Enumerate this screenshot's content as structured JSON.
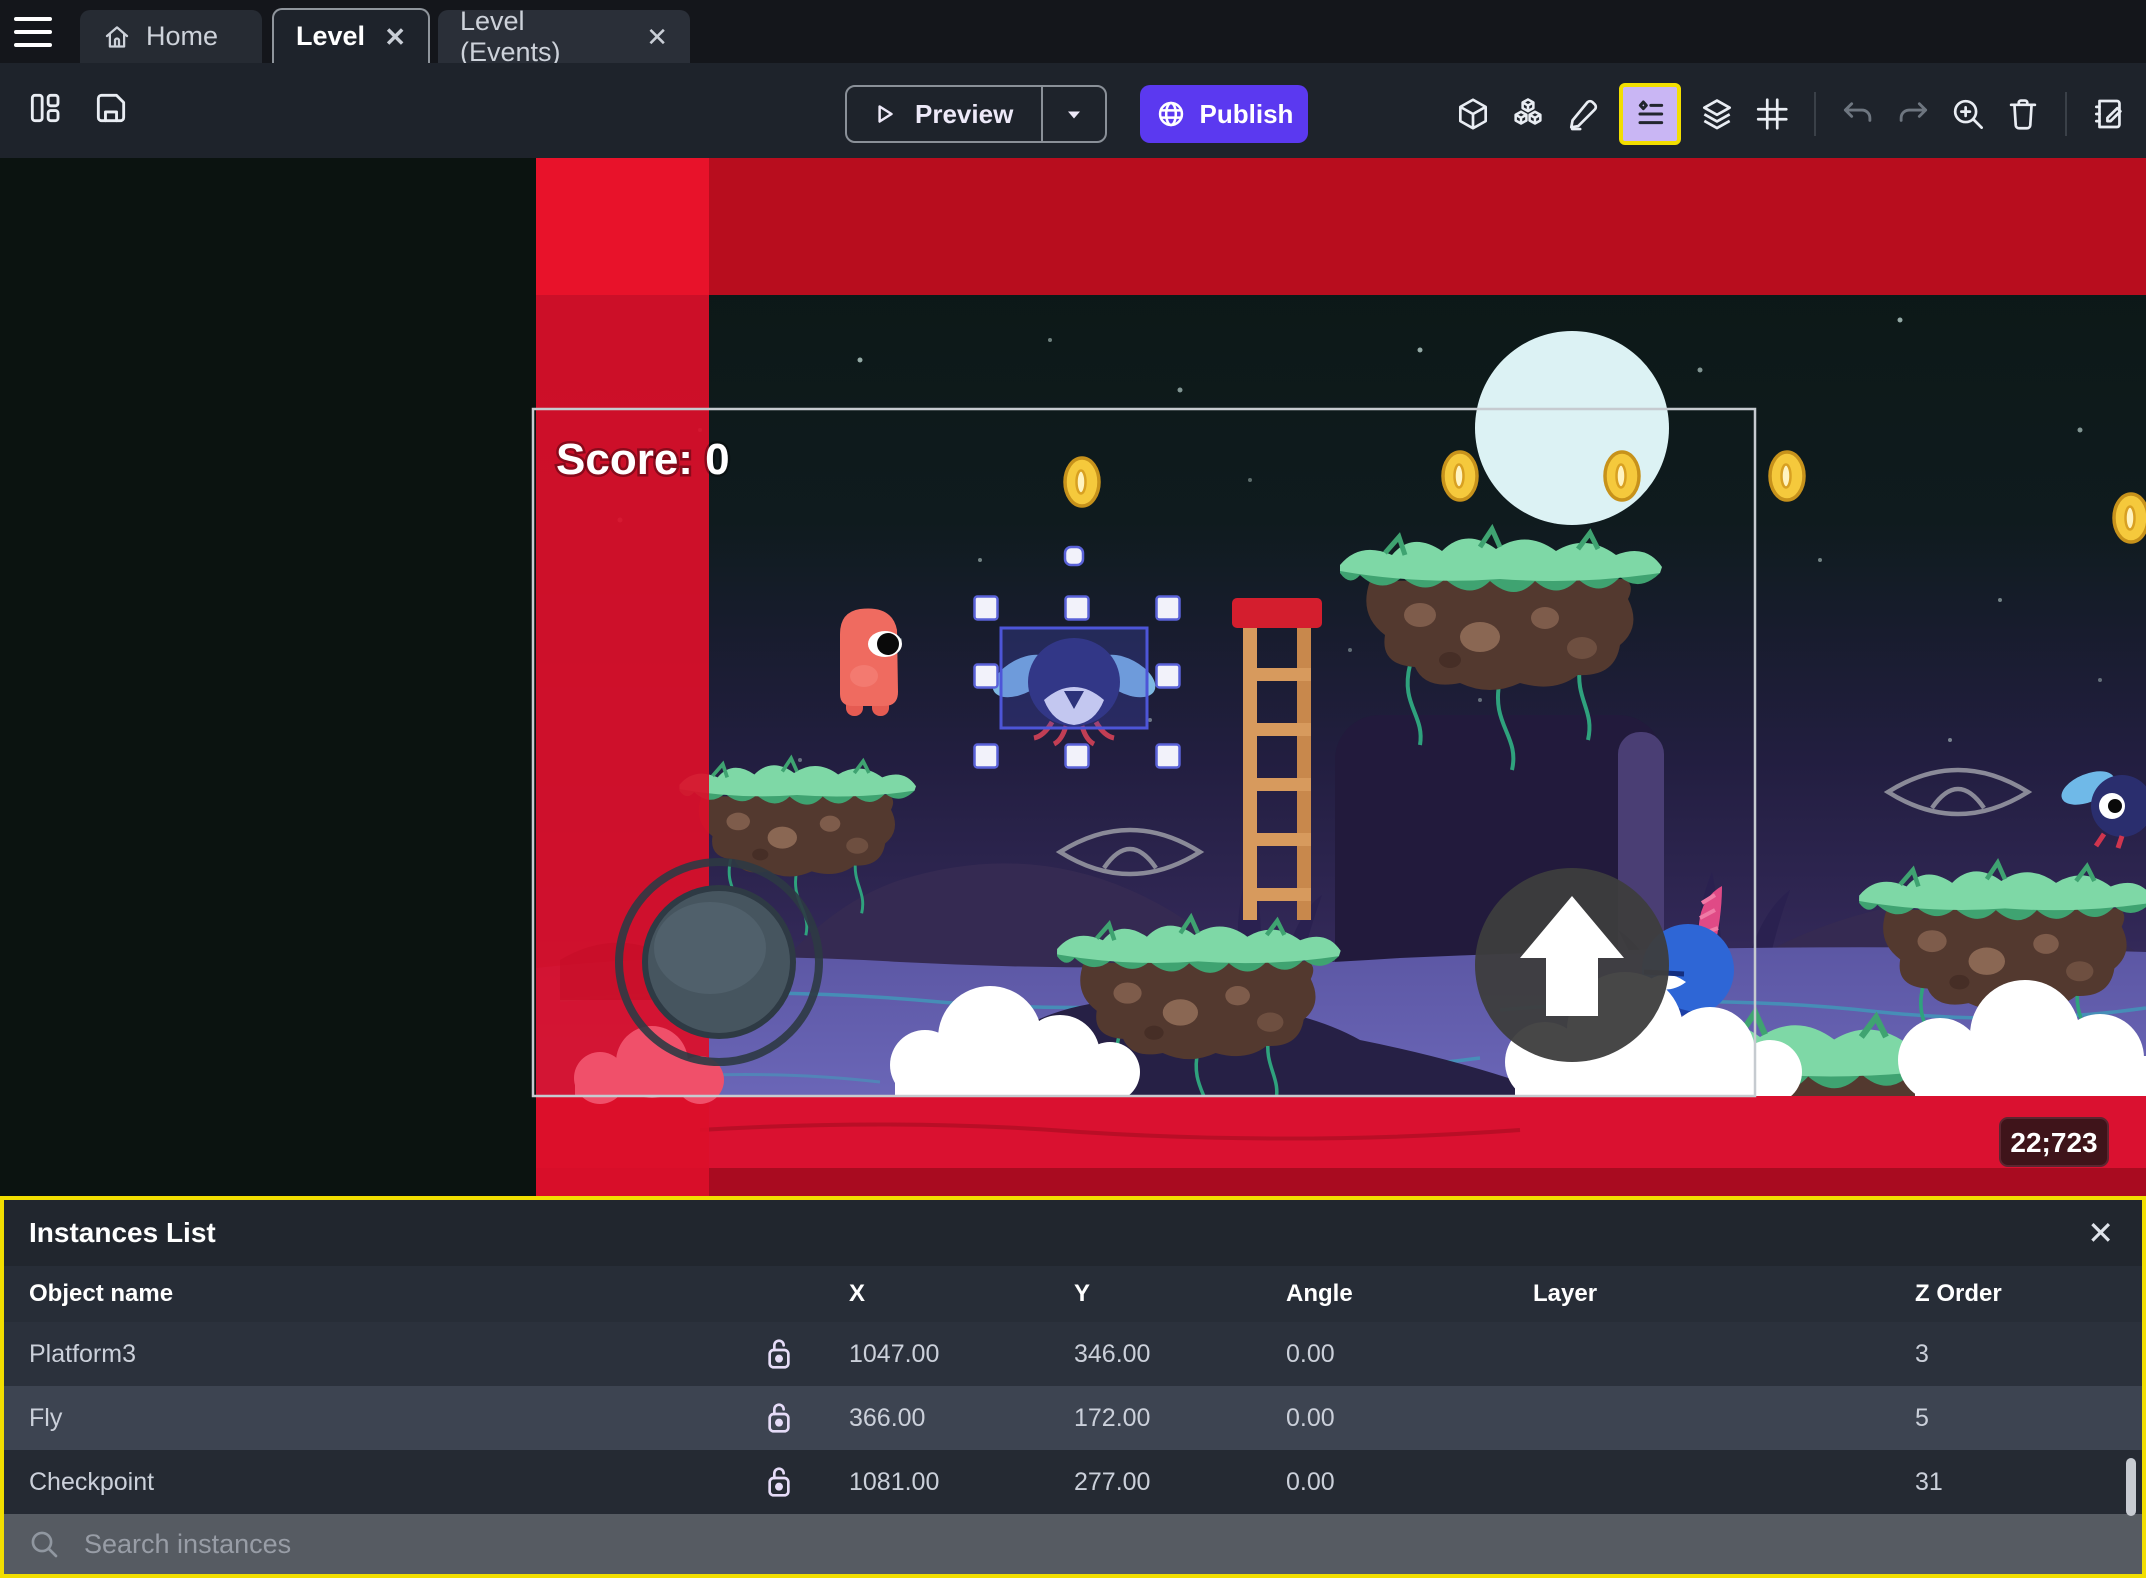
{
  "tabs": {
    "home": "Home",
    "level": "Level",
    "events": "Level (Events)"
  },
  "toolbar": {
    "preview_label": "Preview",
    "publish_label": "Publish",
    "icons": [
      "layout",
      "save",
      "cube-3d",
      "objects-cubes",
      "pencil",
      "instances-list",
      "layers",
      "grid",
      "undo",
      "redo",
      "zoom-in",
      "trash",
      "edit-scene-properties"
    ],
    "highlighted_icon": "instances-list"
  },
  "canvas": {
    "score_label": "Score: 0",
    "coords_badge": "22;723",
    "selected_instance": "Fly"
  },
  "icons_glyphs": {
    "tab_close": "✕",
    "panel_close": "✕"
  },
  "panel": {
    "title": "Instances List",
    "columns": {
      "object_name": "Object name",
      "x": "X",
      "y": "Y",
      "angle": "Angle",
      "layer": "Layer",
      "z_order": "Z Order"
    },
    "rows": [
      {
        "name": "Platform3",
        "x": "1047.00",
        "y": "346.00",
        "angle": "0.00",
        "layer": "",
        "z": "3"
      },
      {
        "name": "Fly",
        "x": "366.00",
        "y": "172.00",
        "angle": "0.00",
        "layer": "",
        "z": "5"
      },
      {
        "name": "Checkpoint",
        "x": "1081.00",
        "y": "277.00",
        "angle": "0.00",
        "layer": "",
        "z": "31"
      }
    ],
    "search_placeholder": "Search instances"
  },
  "colors": {
    "accent_publish": "#5B39F0",
    "highlight_yellow": "#F2DE00",
    "icon_highlight_bg": "#C9B6F4",
    "selection_blue": "#4D55D8",
    "danger_red": "#DA1130",
    "panel_bg": "#21262E"
  }
}
